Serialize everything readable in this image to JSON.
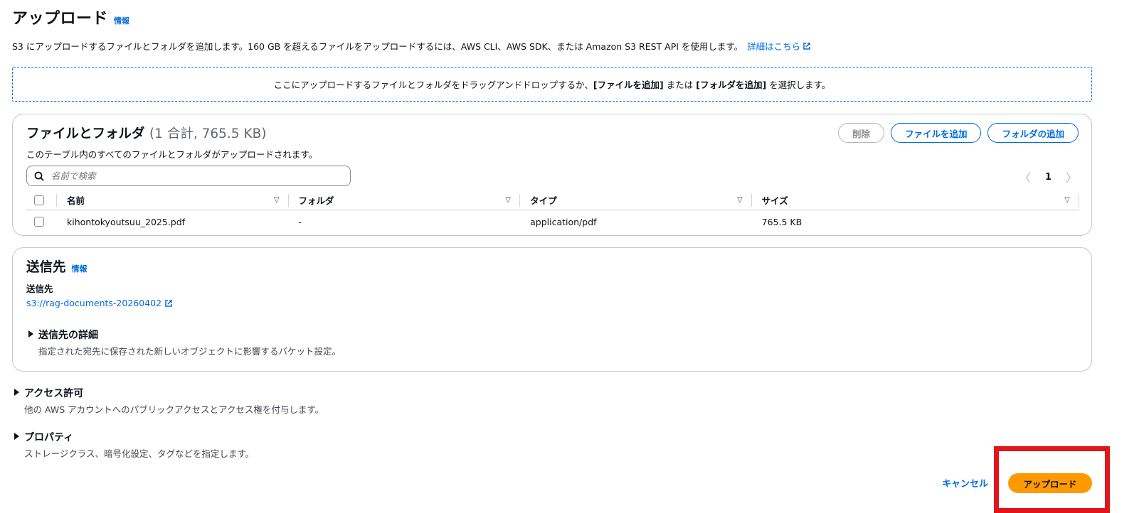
{
  "header": {
    "title": "アップロード",
    "info": "情報"
  },
  "description": {
    "text": "S3 にアップロードするファイルとフォルダを追加します。160 GB を超えるファイルをアップロードするには、AWS CLI、AWS SDK、または Amazon S3 REST API を使用します。",
    "link": "詳細はこちら"
  },
  "dropzone": {
    "prefix": "ここにアップロードするファイルとフォルダをドラッグアンドドロップするか、",
    "add_files": "[ファイルを追加]",
    "middle": " または ",
    "add_folder": "[フォルダを追加]",
    "suffix": " を選択します。"
  },
  "files_panel": {
    "title": "ファイルとフォルダ",
    "count": "(1 合計, 765.5 KB)",
    "subtitle": "このテーブル内のすべてのファイルとフォルダがアップロードされます。",
    "buttons": {
      "delete": "削除",
      "add_files": "ファイルを追加",
      "add_folder": "フォルダの追加"
    },
    "search": {
      "placeholder": "名前で検索"
    },
    "pagination": {
      "page": "1"
    },
    "columns": [
      "名前",
      "フォルダ",
      "タイプ",
      "サイズ"
    ],
    "rows": [
      {
        "name": "kihontokyoutsuu_2025.pdf",
        "folder": "-",
        "type": "application/pdf",
        "size": "765.5 KB"
      }
    ]
  },
  "destination_panel": {
    "title": "送信先",
    "info": "情報",
    "label": "送信先",
    "link": "s3://rag-documents-20260402",
    "details": {
      "title": "送信先の詳細",
      "desc": "指定された宛先に保存された新しいオブジェクトに影響するバケット設定。"
    }
  },
  "access": {
    "title": "アクセス許可",
    "desc": "他の AWS アカウントへのパブリックアクセスとアクセス権を付与します。"
  },
  "properties": {
    "title": "プロパティ",
    "desc": "ストレージクラス、暗号化設定、タグなどを指定します。"
  },
  "footer": {
    "cancel": "キャンセル",
    "upload": "アップロード"
  },
  "colors": {
    "accent": "#006ce0",
    "primary_button": "#ff9900",
    "highlight": "#e0161c"
  },
  "icons": [
    "external-link-icon",
    "search-icon",
    "chevron-left-icon",
    "chevron-right-icon",
    "sort-icon",
    "expand-triangle-icon"
  ]
}
